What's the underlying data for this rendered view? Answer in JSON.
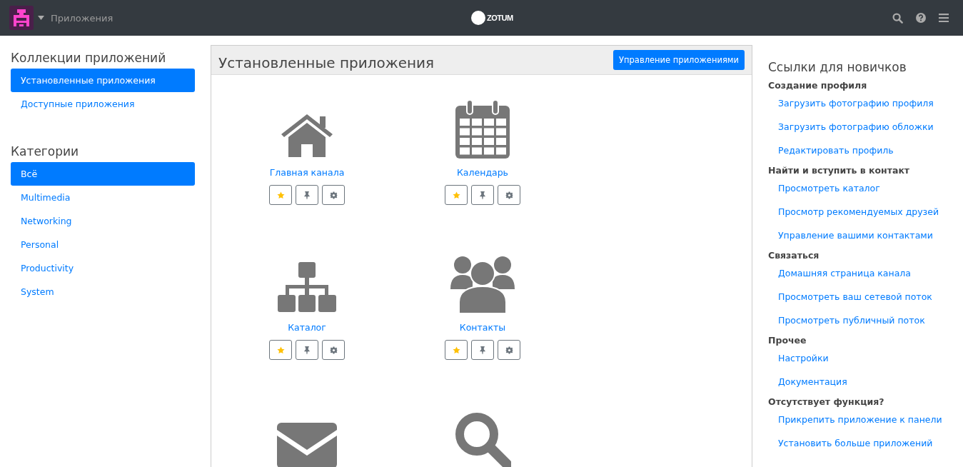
{
  "navbar": {
    "app_title": "Приложения",
    "logo_text": "ZOTUM"
  },
  "sidebar": {
    "collections_title": "Коллекции приложений",
    "collections": [
      {
        "label": "Установленные приложения",
        "selected": true
      },
      {
        "label": "Доступные приложения",
        "selected": false
      }
    ],
    "categories_title": "Категории",
    "categories": [
      {
        "label": "Всё",
        "selected": true
      },
      {
        "label": "Multimedia",
        "selected": false
      },
      {
        "label": "Networking",
        "selected": false
      },
      {
        "label": "Personal",
        "selected": false
      },
      {
        "label": "Productivity",
        "selected": false
      },
      {
        "label": "System",
        "selected": false
      }
    ]
  },
  "main": {
    "title": "Установленные приложения",
    "manage_button": "Управление приложениями",
    "apps": [
      {
        "kind": "home",
        "label": "Главная канала"
      },
      {
        "kind": "calendar",
        "label": "Календарь"
      },
      {
        "kind": "sitemap",
        "label": "Каталог"
      },
      {
        "kind": "users",
        "label": "Контакты"
      },
      {
        "kind": "envelope"
      },
      {
        "kind": "search"
      }
    ]
  },
  "newbie_links": {
    "title": "Ссылки для новичков",
    "sections": [
      {
        "heading": "Создание профиля",
        "links": [
          "Загрузить фотографию профиля",
          "Загрузить фотографию обложки",
          "Редактировать профиль"
        ]
      },
      {
        "heading": "Найти и вступить в контакт",
        "links": [
          "Просмотреть каталог",
          "Просмотр рекомендуемых друзей",
          "Управление вашими контактами"
        ]
      },
      {
        "heading": "Связаться",
        "links": [
          "Домашняя страница канала",
          "Просмотреть ваш сетевой поток",
          "Просмотреть публичный поток"
        ]
      },
      {
        "heading": "Прочее",
        "links": [
          "Настройки",
          "Документация"
        ]
      },
      {
        "heading": "Отсутствует функция?",
        "links": [
          "Прикрепить приложение к панели",
          "Установить больше приложений"
        ]
      }
    ]
  }
}
